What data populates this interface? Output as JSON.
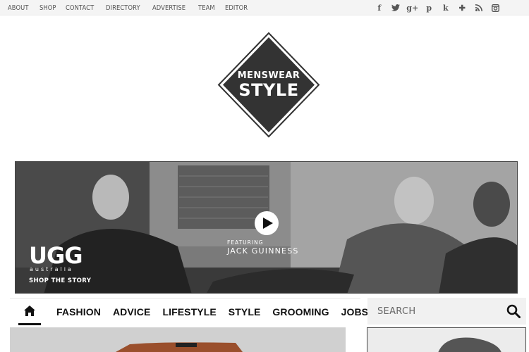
{
  "top_nav": [
    "ABOUT",
    "SHOP",
    "CONTACT",
    "DIRECTORY",
    "ADVERTISE",
    "TEAM",
    "EDITOR"
  ],
  "social": [
    {
      "icon": "facebook-icon",
      "glyph": "f"
    },
    {
      "icon": "twitter-icon",
      "glyph": ""
    },
    {
      "icon": "google-plus-icon",
      "glyph": "g+"
    },
    {
      "icon": "pinterest-icon",
      "glyph": "p"
    },
    {
      "icon": "klout-icon",
      "glyph": "k"
    },
    {
      "icon": "bloglovin-icon",
      "glyph": "✚"
    },
    {
      "icon": "rss-icon",
      "glyph": ""
    },
    {
      "icon": "instagram-icon",
      "glyph": ""
    }
  ],
  "logo": {
    "line1": "MENSWEAR",
    "line2": "STYLE"
  },
  "banner": {
    "brand": "UGG",
    "brand_sub": "australia",
    "cta": "SHOP THE STORY",
    "featuring_label": "FEATURING",
    "featuring_name": "JACK GUINNESS"
  },
  "main_nav": {
    "home_icon": "home-icon",
    "items": [
      "FASHION",
      "ADVICE",
      "LIFESTYLE",
      "STYLE",
      "GROOMING",
      "JOBS"
    ]
  },
  "search": {
    "placeholder": "SEARCH"
  },
  "colors": {
    "topbar": "#f4f4f4",
    "logo": "#333333",
    "search_bg": "#f1f1f1"
  }
}
